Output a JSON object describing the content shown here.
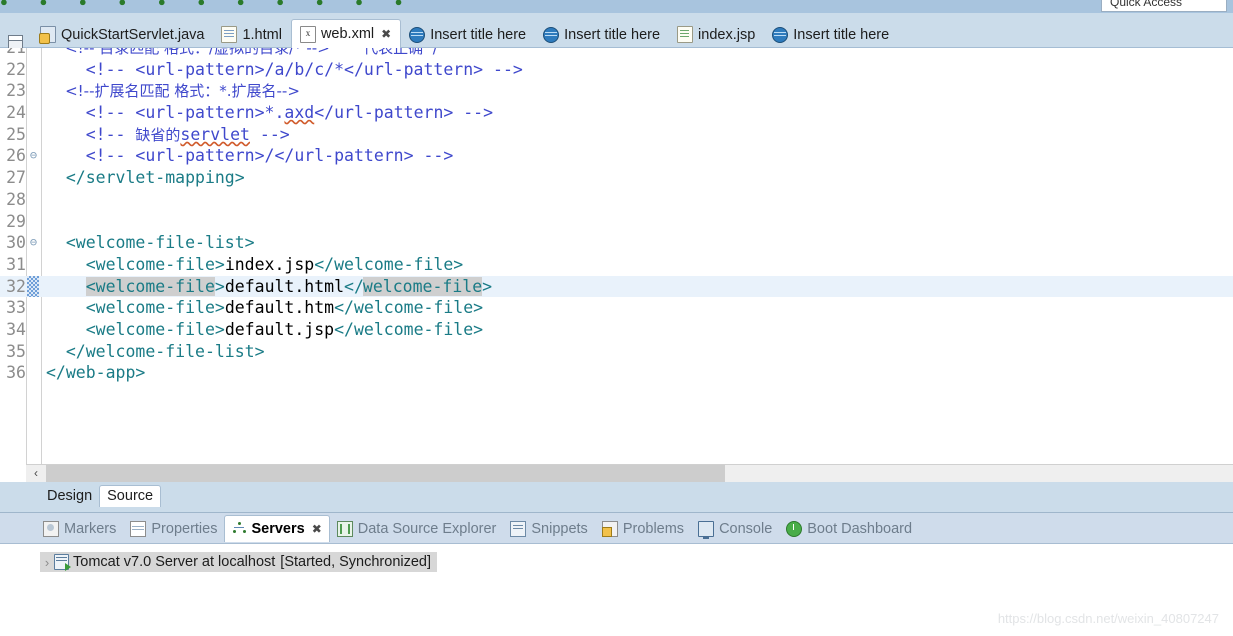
{
  "toolbar": {
    "quick_access_label": "Quick Access",
    "icons": "● ● ● ● ● ● ● ● ● ● ●"
  },
  "editor_tabs": [
    {
      "label": "QuickStartServlet.java",
      "icon": "java-file-icon",
      "active": false,
      "closable": false
    },
    {
      "label": "1.html",
      "icon": "html-file-icon",
      "active": false,
      "closable": false
    },
    {
      "label": "web.xml",
      "icon": "xml-file-icon",
      "active": true,
      "closable": true,
      "close_glyph": "✖"
    },
    {
      "label": "Insert title here",
      "icon": "globe-icon",
      "active": false,
      "closable": false
    },
    {
      "label": "Insert title here",
      "icon": "globe-icon",
      "active": false,
      "closable": false
    },
    {
      "label": "index.jsp",
      "icon": "jsp-file-icon",
      "active": false,
      "closable": false
    },
    {
      "label": "Insert title here",
      "icon": "globe-icon",
      "active": false,
      "closable": false
    }
  ],
  "editor": {
    "file": "web.xml",
    "caret_line": 32,
    "lines": [
      {
        "num": "21",
        "fold": "",
        "clipped": true,
        "segments": [
          {
            "text": "    <!-- 目录匹配 格式：/虚拟的目录/* -->       代表正确  /",
            "style": "comment-cn"
          }
        ]
      },
      {
        "num": "22",
        "fold": "",
        "segments": [
          {
            "text": "    <!-- <url-pattern>/a/b/c/*</url-pattern> -->",
            "style": "comment"
          }
        ]
      },
      {
        "num": "23",
        "fold": "",
        "segments": [
          {
            "text": "    <!--扩展名匹配 格式：*.扩展名-->",
            "style": "comment-cn"
          }
        ]
      },
      {
        "num": "24",
        "fold": "",
        "segments": [
          {
            "text": "    <!-- <url-pattern>*.",
            "style": "comment"
          },
          {
            "text": "axd",
            "style": "comment-squiggle"
          },
          {
            "text": "</url-pattern> -->",
            "style": "comment"
          }
        ]
      },
      {
        "num": "25",
        "fold": "",
        "segments": [
          {
            "text": "    <!-- ",
            "style": "comment"
          },
          {
            "text": "缺省的",
            "style": "comment-cn"
          },
          {
            "text": "servlet",
            "style": "comment-squiggle"
          },
          {
            "text": " -->",
            "style": "comment"
          }
        ]
      },
      {
        "num": "26",
        "fold": "⊖",
        "segments": [
          {
            "text": "    <!-- <url-pattern>/</url-pattern> -->",
            "style": "comment"
          }
        ]
      },
      {
        "num": "27",
        "fold": "",
        "segments": [
          {
            "text": "  </servlet-mapping>",
            "style": "tag"
          }
        ]
      },
      {
        "num": "28",
        "fold": "",
        "segments": []
      },
      {
        "num": "29",
        "fold": "",
        "segments": []
      },
      {
        "num": "30",
        "fold": "⊖",
        "segments": [
          {
            "text": "  <welcome-file-list>",
            "style": "tag"
          }
        ]
      },
      {
        "num": "31",
        "fold": "",
        "segments": [
          {
            "text": "    <welcome-file>",
            "style": "tag"
          },
          {
            "text": "index.jsp",
            "style": "text"
          },
          {
            "text": "</welcome-file>",
            "style": "tag"
          }
        ]
      },
      {
        "num": "32",
        "fold": "",
        "highlighted": true,
        "changed": true,
        "segments": [
          {
            "text": "    ",
            "style": "tag"
          },
          {
            "text": "<welcome-file",
            "style": "tag-matched"
          },
          {
            "text": ">",
            "style": "tag"
          },
          {
            "text": "default.html",
            "style": "text"
          },
          {
            "text": "</",
            "style": "tag"
          },
          {
            "text": "CARET",
            "style": "caret"
          },
          {
            "text": "welcome-file",
            "style": "tag-matched"
          },
          {
            "text": ">",
            "style": "tag"
          }
        ]
      },
      {
        "num": "33",
        "fold": "",
        "segments": [
          {
            "text": "    <welcome-file>",
            "style": "tag"
          },
          {
            "text": "default.htm",
            "style": "text"
          },
          {
            "text": "</welcome-file>",
            "style": "tag"
          }
        ]
      },
      {
        "num": "34",
        "fold": "",
        "segments": [
          {
            "text": "    <welcome-file>",
            "style": "tag"
          },
          {
            "text": "default.jsp",
            "style": "text"
          },
          {
            "text": "</welcome-file>",
            "style": "tag"
          }
        ]
      },
      {
        "num": "35",
        "fold": "",
        "segments": [
          {
            "text": "  </welcome-file-list>",
            "style": "tag"
          }
        ]
      },
      {
        "num": "36",
        "fold": "",
        "segments": [
          {
            "text": "</web-app>",
            "style": "tag"
          }
        ]
      }
    ]
  },
  "editor_scrollbar": {
    "left_arrow_glyph": "‹"
  },
  "design_source_tabs": [
    {
      "label": "Design",
      "active": false
    },
    {
      "label": "Source",
      "active": true
    }
  ],
  "bottom_tabs": [
    {
      "label": "Markers",
      "icon": "markers-icon",
      "active": false
    },
    {
      "label": "Properties",
      "icon": "properties-icon",
      "active": false
    },
    {
      "label": "Servers",
      "icon": "servers-icon",
      "active": true,
      "close_glyph": "✖"
    },
    {
      "label": "Data Source Explorer",
      "icon": "data-source-explorer-icon",
      "active": false
    },
    {
      "label": "Snippets",
      "icon": "snippets-icon",
      "active": false
    },
    {
      "label": "Problems",
      "icon": "problems-icon",
      "active": false
    },
    {
      "label": "Console",
      "icon": "console-icon",
      "active": false
    },
    {
      "label": "Boot Dashboard",
      "icon": "boot-dashboard-icon",
      "active": false
    }
  ],
  "servers_panel": {
    "rows": [
      {
        "twisty": "›",
        "icon": "server-icon",
        "name": "Tomcat v7.0 Server at localhost",
        "state": "[Started, Synchronized]",
        "selected": true
      }
    ]
  },
  "watermark": {
    "text": "https://blog.csdn.net/weixin_40807247"
  },
  "colors": {
    "tab_bar": "#cbdcea",
    "bottom_tab_bar": "#cfdceb",
    "toolbar": "#a8c4de",
    "comment": "#3f48cc",
    "tag": "#1a7b86",
    "text": "#000000",
    "line_number": "#8c8c8c",
    "current_line_highlight": "#e9f2fb",
    "matched_tag_highlight": "#cfcfcf",
    "selection": "#d7d7d7",
    "watermark": "#e2e4e6"
  }
}
